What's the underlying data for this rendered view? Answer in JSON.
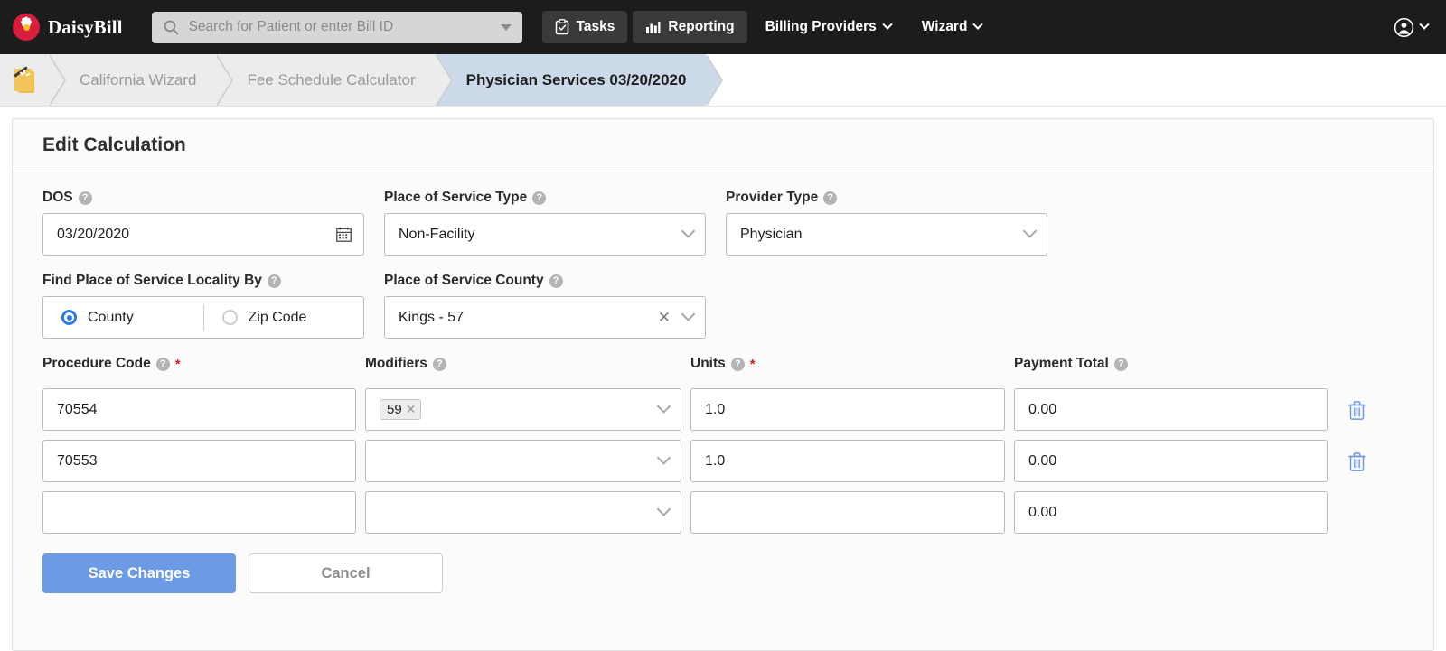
{
  "navbar": {
    "brand_name": "DaisyBill",
    "logo_icon": "daisy-flower-icon",
    "search": {
      "placeholder": "Search for Patient or enter Bill ID",
      "value": "",
      "icon": "search-icon",
      "caret_icon": "caret-down-icon"
    },
    "items": [
      {
        "label": "Tasks",
        "icon": "clipboard-check-icon",
        "boxed": true,
        "caret": false
      },
      {
        "label": "Reporting",
        "icon": "bar-chart-icon",
        "boxed": true,
        "caret": false
      },
      {
        "label": "Billing Providers",
        "icon": "",
        "boxed": false,
        "caret": true
      },
      {
        "label": "Wizard",
        "icon": "",
        "boxed": false,
        "caret": true
      }
    ],
    "account": {
      "icon": "user-circle-icon",
      "caret_icon": "chevron-down-icon"
    },
    "colors": {
      "background": "#1c1c1c",
      "boxed_button": "#3a3a3a",
      "brand_red": "#d81e3c"
    }
  },
  "breadcrumb": {
    "icon": "wizard-document-icon",
    "items": [
      {
        "label": "California Wizard",
        "active": false
      },
      {
        "label": "Fee Schedule Calculator",
        "active": false
      },
      {
        "label": "Physician Services 03/20/2020",
        "active": true
      }
    ],
    "active_color": "#ccd9e8"
  },
  "card": {
    "title": "Edit Calculation"
  },
  "form": {
    "dos": {
      "label": "DOS",
      "help_icon": "question-circle-icon",
      "value": "03/20/2020",
      "icon": "calendar-icon"
    },
    "place_of_service_type": {
      "label": "Place of Service Type",
      "help_icon": "question-circle-icon",
      "value": "Non-Facility",
      "caret_icon": "chevron-down-icon"
    },
    "provider_type": {
      "label": "Provider Type",
      "help_icon": "question-circle-icon",
      "value": "Physician",
      "caret_icon": "chevron-down-icon"
    },
    "locality_by": {
      "label": "Find Place of Service Locality By",
      "help_icon": "question-circle-icon",
      "options": [
        {
          "label": "County",
          "selected": true
        },
        {
          "label": "Zip Code",
          "selected": false
        }
      ],
      "selected_color": "#2f7ae0"
    },
    "place_of_service_county": {
      "label": "Place of Service County",
      "help_icon": "question-circle-icon",
      "value": "Kings - 57",
      "clear_icon": "x-icon",
      "caret_icon": "chevron-down-icon"
    }
  },
  "procedure_table": {
    "columns": [
      {
        "label": "Procedure Code",
        "help_icon": "question-circle-icon",
        "required": true
      },
      {
        "label": "Modifiers",
        "help_icon": "question-circle-icon",
        "required": false
      },
      {
        "label": "Units",
        "help_icon": "question-circle-icon",
        "required": true
      },
      {
        "label": "Payment Total",
        "help_icon": "question-circle-icon",
        "required": false
      }
    ],
    "required_marker": "*",
    "rows": [
      {
        "code": "70554",
        "modifiers": [
          {
            "label": "59",
            "remove_icon": "x-icon"
          }
        ],
        "units": "1.0",
        "payment_total": "0.00",
        "delete_icon": "trash-icon",
        "has_delete": true
      },
      {
        "code": "70553",
        "modifiers": [],
        "units": "1.0",
        "payment_total": "0.00",
        "delete_icon": "trash-icon",
        "has_delete": true
      },
      {
        "code": "",
        "modifiers": [],
        "units": "",
        "payment_total": "0.00",
        "delete_icon": "",
        "has_delete": false
      }
    ],
    "delete_icon_color": "#6d9ae4"
  },
  "actions": {
    "save_label": "Save Changes",
    "cancel_label": "Cancel",
    "primary_color": "#6d9ae4"
  }
}
